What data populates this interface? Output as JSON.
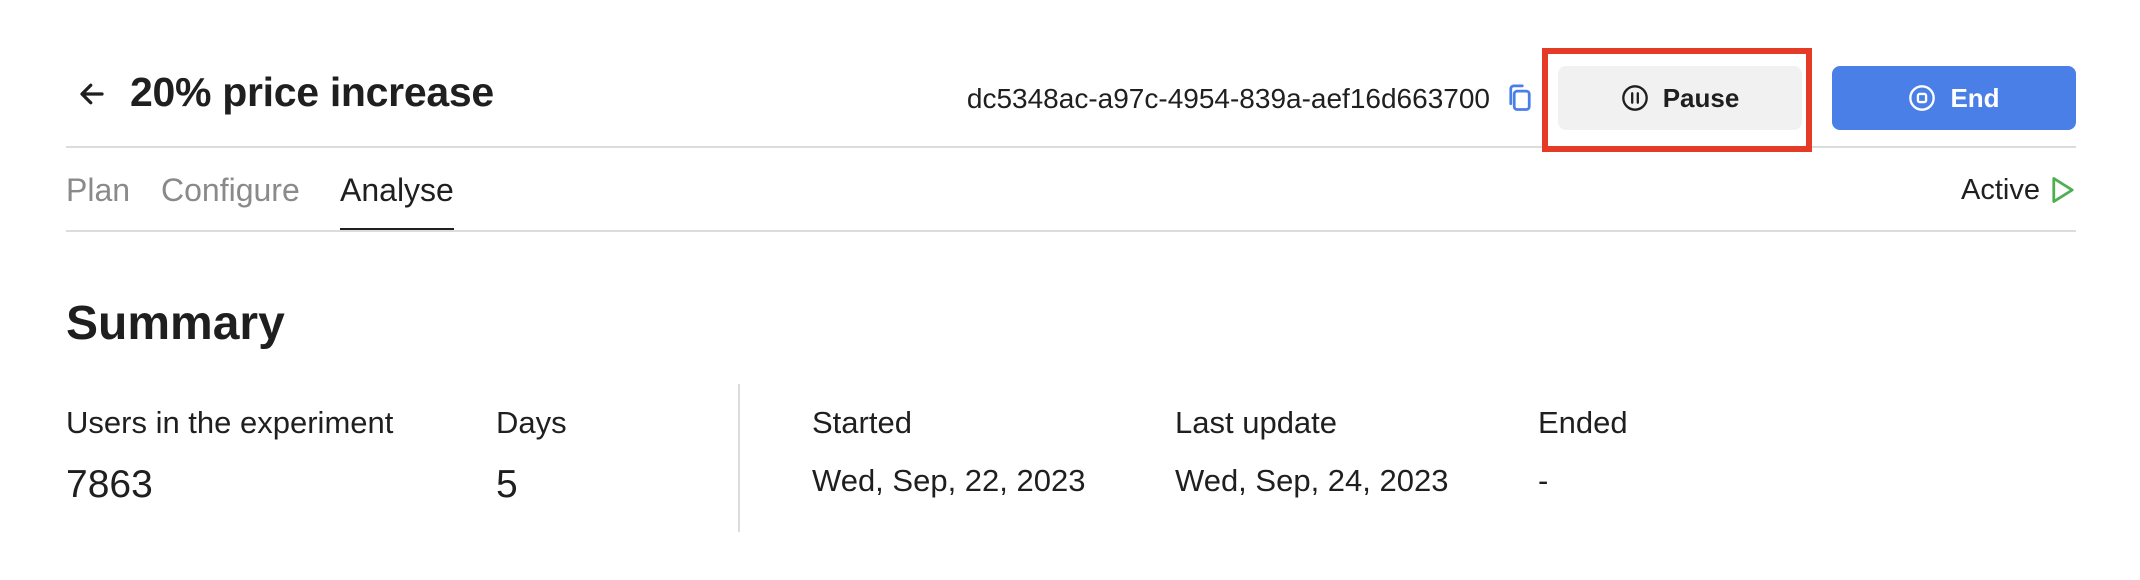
{
  "header": {
    "back_icon": "arrow-left-icon",
    "title": "20% price increase",
    "experiment_id": "dc5348ac-a97c-4954-839a-aef16d663700",
    "copy_icon": "copy-icon",
    "pause_label": "Pause",
    "pause_icon": "pause-circle-icon",
    "end_label": "End",
    "end_icon": "stop-circle-icon"
  },
  "tabs": [
    {
      "label": "Plan",
      "active": false
    },
    {
      "label": "Configure",
      "active": false
    },
    {
      "label": "Analyse",
      "active": true
    }
  ],
  "status": {
    "label": "Active",
    "icon": "play-triangle-icon",
    "color": "#4caf50"
  },
  "summary": {
    "title": "Summary",
    "users_label": "Users in the experiment",
    "users_value": "7863",
    "days_label": "Days",
    "days_value": "5",
    "started_label": "Started",
    "started_value": "Wed, Sep, 22, 2023",
    "last_update_label": "Last update",
    "last_update_value": "Wed, Sep, 24, 2023",
    "ended_label": "Ended",
    "ended_value": "-"
  },
  "colors": {
    "accent": "#4b7fe8",
    "highlight": "#e53a25",
    "secondary_button_bg": "#f1f1f1"
  }
}
